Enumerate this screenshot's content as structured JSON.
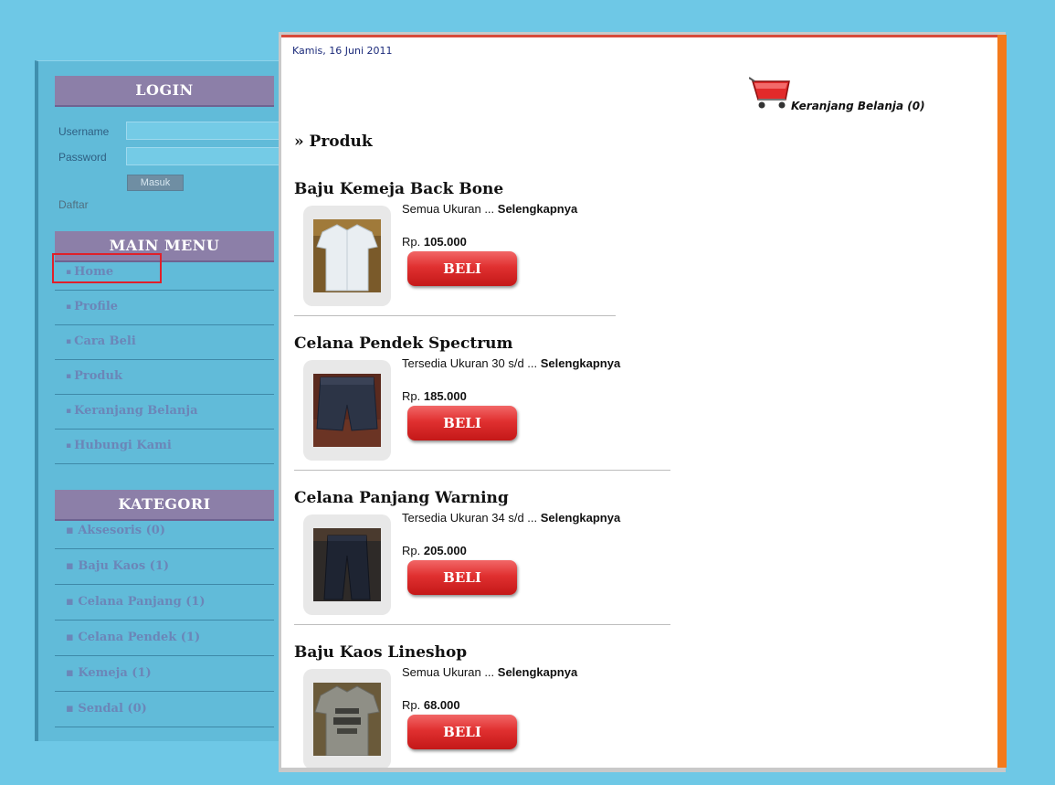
{
  "colors": {
    "background": "#6ec8e6",
    "sidebar": "#61bbd9",
    "header": "#8c7fa8",
    "accent_orange": "#f37a1c",
    "button_red": "#e03030",
    "highlight": "#e0202a"
  },
  "login": {
    "heading": "LOGIN",
    "username_label": "Username",
    "username_value": "",
    "password_label": "Password",
    "password_value": "",
    "submit_label": "Masuk",
    "register_link": "Daftar"
  },
  "main_menu": {
    "heading": "MAIN MENU",
    "items": [
      {
        "label": "Home"
      },
      {
        "label": "Profile"
      },
      {
        "label": "Cara Beli"
      },
      {
        "label": "Produk"
      },
      {
        "label": "Keranjang Belanja"
      },
      {
        "label": "Hubungi Kami"
      }
    ]
  },
  "categories": {
    "heading": "KATEGORI",
    "items": [
      {
        "label": "Aksesoris (0)"
      },
      {
        "label": "Baju Kaos (1)"
      },
      {
        "label": "Celana Panjang (1)"
      },
      {
        "label": "Celana Pendek (1)"
      },
      {
        "label": "Kemeja (1)"
      },
      {
        "label": "Sendal (0)"
      }
    ]
  },
  "content": {
    "date": "Kamis, 16 Juni 2011",
    "cart_label": "Keranjang Belanja (0)",
    "cart_icon": "shopping-cart-icon",
    "section_title": "» Produk",
    "more_label": "Selengkapnya",
    "price_prefix": "Rp.",
    "buy_label": "BELI",
    "products": [
      {
        "name": "Baju Kemeja Back Bone",
        "desc": "Semua Ukuran ...",
        "price": "105.000",
        "image_icon": "shirt-photo"
      },
      {
        "name": "Celana Pendek Spectrum",
        "desc": "Tersedia Ukuran 30 s/d ...",
        "price": "185.000",
        "image_icon": "shorts-photo"
      },
      {
        "name": "Celana Panjang Warning",
        "desc": "Tersedia Ukuran 34 s/d ...",
        "price": "205.000",
        "image_icon": "pants-photo"
      },
      {
        "name": "Baju Kaos Lineshop",
        "desc": "Semua Ukuran ...",
        "price": "68.000",
        "image_icon": "tshirt-photo"
      }
    ]
  }
}
